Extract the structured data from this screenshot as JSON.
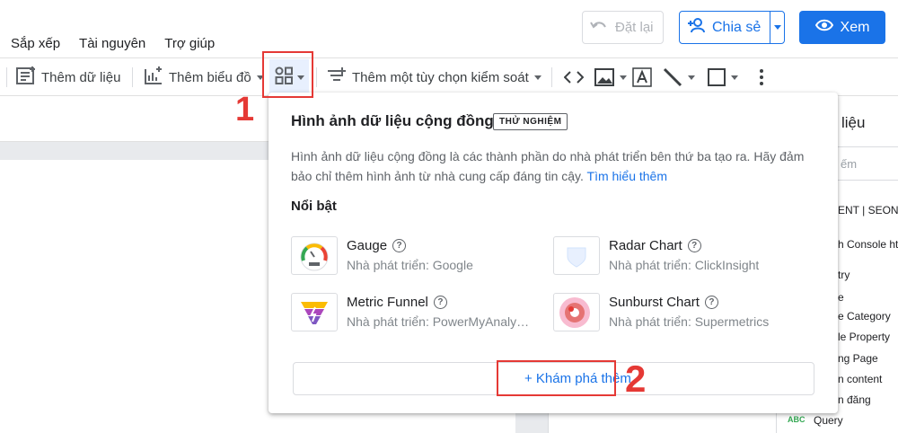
{
  "header": {
    "reset_label": "Đặt lại",
    "share_label": "Chia sẻ",
    "view_label": "Xem"
  },
  "menu": [
    "Sắp xếp",
    "Tài nguyên",
    "Trợ giúp"
  ],
  "toolbar": {
    "add_data_label": "Thêm dữ liệu",
    "add_chart_label": "Thêm biểu đồ",
    "add_control_label": "Thêm một tùy chọn kiểm soát"
  },
  "annotations": {
    "step1": "1",
    "step2": "2"
  },
  "right_panel": {
    "title": "liệu",
    "search_placeholder": "ếm",
    "items": [
      "ENT | SEONG",
      "h Console htt",
      "try",
      "e",
      "e Category",
      "le Property",
      "ng Page",
      "n content",
      "n đăng",
      "Query"
    ],
    "query_type_badge": "ABC"
  },
  "popup": {
    "title": "Hình ảnh dữ liệu cộng đồng",
    "badge": "THỬ NGHIỆM",
    "description": "Hình ảnh dữ liệu cộng đồng là các thành phần do nhà phát triển bên thứ ba tạo ra. Hãy đảm bảo chỉ thêm hình ảnh từ nhà cung cấp đáng tin cậy.",
    "learn_more": "Tìm hiểu thêm",
    "section_title": "Nổi bật",
    "visualizations": [
      {
        "name": "Gauge",
        "developer": "Nhà phát triển: Google",
        "icon": "gauge-thumb"
      },
      {
        "name": "Radar Chart",
        "developer": "Nhà phát triển: ClickInsight",
        "icon": "radar-thumb"
      },
      {
        "name": "Metric Funnel",
        "developer": "Nhà phát triển: PowerMyAnalytics",
        "icon": "funnel-thumb"
      },
      {
        "name": "Sunburst Chart",
        "developer": "Nhà phát triển: Supermetrics",
        "icon": "sunburst-thumb"
      }
    ],
    "explore_more": "+ Khám phá thêm"
  },
  "colors": {
    "accent": "#1a73e8",
    "highlight": "#e53935"
  }
}
